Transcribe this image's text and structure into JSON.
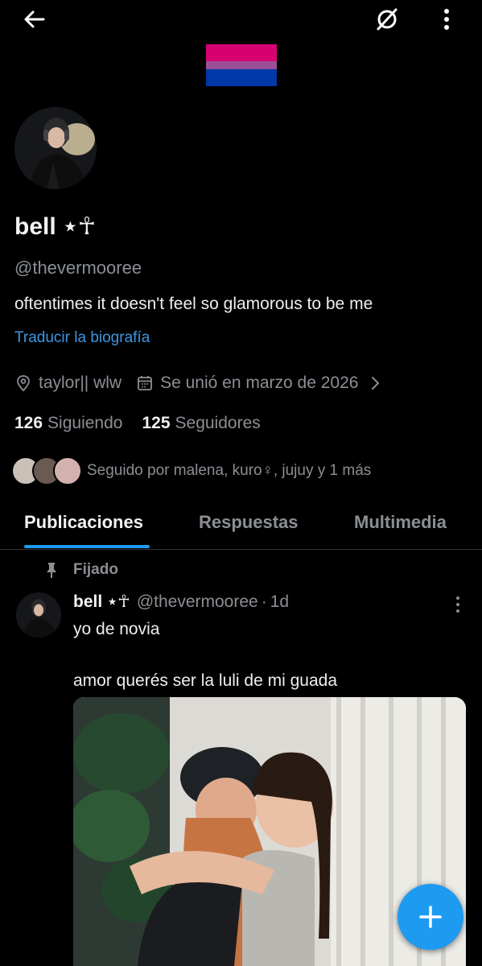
{
  "header": {
    "back_icon": "arrow-left-icon",
    "nostr_icon": "nostr-icon",
    "more_icon": "more-vertical-icon"
  },
  "banner": {
    "flag_colors": [
      "#d60270",
      "#d60270",
      "#9b4f96",
      "#0038a8",
      "#0038a8"
    ]
  },
  "profile": {
    "display_name": "bell ⋆☥",
    "handle": "@thevermooree",
    "bio": "oftentimes it doesn't feel so glamorous to be me",
    "translate_label": "Traducir la biografía",
    "location": "taylor|| wlw",
    "joined": "Se unió en marzo de 2026",
    "following_count": "126",
    "following_label": "Siguiendo",
    "followers_count": "125",
    "followers_label": "Seguidores",
    "followed_by": "Seguido por malena, kuro♀, jujuy y 1 más"
  },
  "tabs": [
    {
      "label": "Publicaciones",
      "active": true
    },
    {
      "label": "Respuestas",
      "active": false
    },
    {
      "label": "Multimedia",
      "active": false
    }
  ],
  "post": {
    "pinned_label": "Fijado",
    "name": "bell ⋆☥",
    "handle": "@thevermooree",
    "separator": "·",
    "time": "1d",
    "text": "yo de novia\n\namor querés ser la luli de mi guada"
  },
  "colors": {
    "accent": "#1d9bf0",
    "link": "#3d97e3",
    "muted": "#8b8f94",
    "background": "#000000"
  }
}
